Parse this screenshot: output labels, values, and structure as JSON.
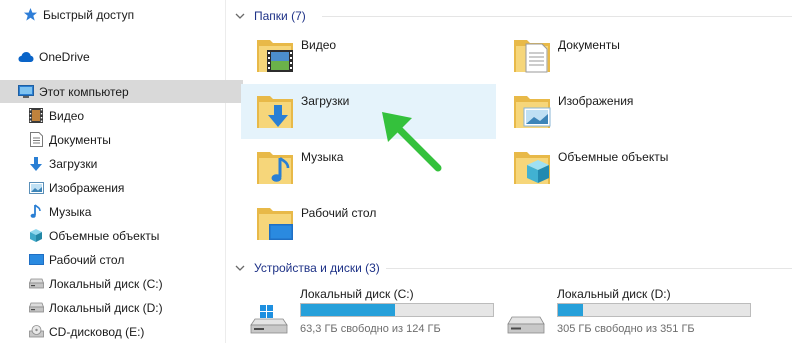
{
  "sidebar": {
    "items": [
      {
        "label": "Быстрый доступ",
        "icon": "star-icon"
      },
      {
        "label": "OneDrive",
        "icon": "cloud-icon"
      },
      {
        "label": "Этот компьютер",
        "icon": "monitor-icon",
        "selected": true
      },
      {
        "label": "Видео",
        "icon": "film-icon"
      },
      {
        "label": "Документы",
        "icon": "document-icon"
      },
      {
        "label": "Загрузки",
        "icon": "download-arrow-icon"
      },
      {
        "label": "Изображения",
        "icon": "picture-icon"
      },
      {
        "label": "Музыка",
        "icon": "music-note-icon"
      },
      {
        "label": "Объемные объекты",
        "icon": "cube-icon"
      },
      {
        "label": "Рабочий стол",
        "icon": "desktop-icon"
      },
      {
        "label": "Локальный диск (C:)",
        "icon": "drive-icon"
      },
      {
        "label": "Локальный диск (D:)",
        "icon": "drive-icon"
      },
      {
        "label": "CD-дисковод (E:)",
        "icon": "cd-drive-icon"
      }
    ]
  },
  "folders_group": {
    "title": "Папки (7)",
    "items": [
      {
        "label": "Видео",
        "icon": "video-folder-icon"
      },
      {
        "label": "Документы",
        "icon": "documents-folder-icon"
      },
      {
        "label": "Загрузки",
        "icon": "downloads-folder-icon",
        "highlighted": true
      },
      {
        "label": "Изображения",
        "icon": "pictures-folder-icon"
      },
      {
        "label": "Музыка",
        "icon": "music-folder-icon"
      },
      {
        "label": "Объемные объекты",
        "icon": "3d-objects-folder-icon"
      },
      {
        "label": "Рабочий стол",
        "icon": "desktop-folder-icon"
      }
    ]
  },
  "drives_group": {
    "title": "Устройства и диски (3)",
    "items": [
      {
        "name": "Локальный диск (C:)",
        "free_text": "63,3 ГБ свободно из 124 ГБ",
        "used_fraction": 0.49,
        "icon": "windows-drive-icon"
      },
      {
        "name": "Локальный диск (D:)",
        "free_text": "305 ГБ свободно из 351 ГБ",
        "used_fraction": 0.13,
        "icon": "drive-icon"
      }
    ]
  },
  "colors": {
    "selection": "#d9d9d9",
    "highlight": "#e5f3fb",
    "group_header": "#1e3287",
    "bar_fill": "#26a0da",
    "annotation_arrow": "#34c13c"
  }
}
